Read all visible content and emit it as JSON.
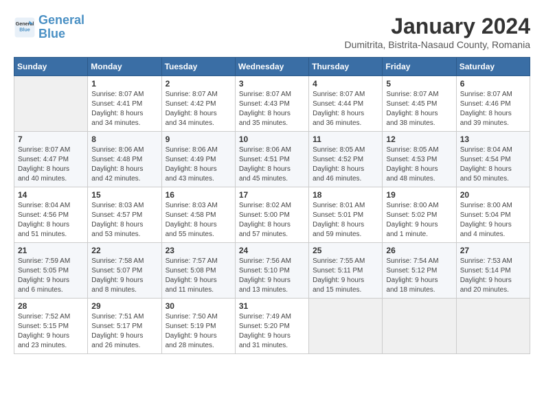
{
  "logo": {
    "line1": "General",
    "line2": "Blue"
  },
  "title": "January 2024",
  "subtitle": "Dumitrita, Bistrita-Nasaud County, Romania",
  "days_of_week": [
    "Sunday",
    "Monday",
    "Tuesday",
    "Wednesday",
    "Thursday",
    "Friday",
    "Saturday"
  ],
  "weeks": [
    [
      {
        "day": "",
        "info": ""
      },
      {
        "day": "1",
        "info": "Sunrise: 8:07 AM\nSunset: 4:41 PM\nDaylight: 8 hours\nand 34 minutes."
      },
      {
        "day": "2",
        "info": "Sunrise: 8:07 AM\nSunset: 4:42 PM\nDaylight: 8 hours\nand 34 minutes."
      },
      {
        "day": "3",
        "info": "Sunrise: 8:07 AM\nSunset: 4:43 PM\nDaylight: 8 hours\nand 35 minutes."
      },
      {
        "day": "4",
        "info": "Sunrise: 8:07 AM\nSunset: 4:44 PM\nDaylight: 8 hours\nand 36 minutes."
      },
      {
        "day": "5",
        "info": "Sunrise: 8:07 AM\nSunset: 4:45 PM\nDaylight: 8 hours\nand 38 minutes."
      },
      {
        "day": "6",
        "info": "Sunrise: 8:07 AM\nSunset: 4:46 PM\nDaylight: 8 hours\nand 39 minutes."
      }
    ],
    [
      {
        "day": "7",
        "info": ""
      },
      {
        "day": "8",
        "info": "Sunrise: 8:06 AM\nSunset: 4:48 PM\nDaylight: 8 hours\nand 42 minutes."
      },
      {
        "day": "9",
        "info": "Sunrise: 8:06 AM\nSunset: 4:49 PM\nDaylight: 8 hours\nand 43 minutes."
      },
      {
        "day": "10",
        "info": "Sunrise: 8:06 AM\nSunset: 4:51 PM\nDaylight: 8 hours\nand 45 minutes."
      },
      {
        "day": "11",
        "info": "Sunrise: 8:05 AM\nSunset: 4:52 PM\nDaylight: 8 hours\nand 46 minutes."
      },
      {
        "day": "12",
        "info": "Sunrise: 8:05 AM\nSunset: 4:53 PM\nDaylight: 8 hours\nand 48 minutes."
      },
      {
        "day": "13",
        "info": "Sunrise: 8:04 AM\nSunset: 4:54 PM\nDaylight: 8 hours\nand 50 minutes."
      }
    ],
    [
      {
        "day": "14",
        "info": ""
      },
      {
        "day": "15",
        "info": "Sunrise: 8:03 AM\nSunset: 4:57 PM\nDaylight: 8 hours\nand 53 minutes."
      },
      {
        "day": "16",
        "info": "Sunrise: 8:03 AM\nSunset: 4:58 PM\nDaylight: 8 hours\nand 55 minutes."
      },
      {
        "day": "17",
        "info": "Sunrise: 8:02 AM\nSunset: 5:00 PM\nDaylight: 8 hours\nand 57 minutes."
      },
      {
        "day": "18",
        "info": "Sunrise: 8:01 AM\nSunset: 5:01 PM\nDaylight: 8 hours\nand 59 minutes."
      },
      {
        "day": "19",
        "info": "Sunrise: 8:00 AM\nSunset: 5:02 PM\nDaylight: 9 hours\nand 1 minute."
      },
      {
        "day": "20",
        "info": "Sunrise: 8:00 AM\nSunset: 5:04 PM\nDaylight: 9 hours\nand 4 minutes."
      }
    ],
    [
      {
        "day": "21",
        "info": "Sunrise: 7:59 AM\nSunset: 5:05 PM\nDaylight: 9 hours\nand 6 minutes."
      },
      {
        "day": "22",
        "info": "Sunrise: 7:58 AM\nSunset: 5:07 PM\nDaylight: 9 hours\nand 8 minutes."
      },
      {
        "day": "23",
        "info": "Sunrise: 7:57 AM\nSunset: 5:08 PM\nDaylight: 9 hours\nand 11 minutes."
      },
      {
        "day": "24",
        "info": "Sunrise: 7:56 AM\nSunset: 5:10 PM\nDaylight: 9 hours\nand 13 minutes."
      },
      {
        "day": "25",
        "info": "Sunrise: 7:55 AM\nSunset: 5:11 PM\nDaylight: 9 hours\nand 15 minutes."
      },
      {
        "day": "26",
        "info": "Sunrise: 7:54 AM\nSunset: 5:12 PM\nDaylight: 9 hours\nand 18 minutes."
      },
      {
        "day": "27",
        "info": "Sunrise: 7:53 AM\nSunset: 5:14 PM\nDaylight: 9 hours\nand 20 minutes."
      }
    ],
    [
      {
        "day": "28",
        "info": "Sunrise: 7:52 AM\nSunset: 5:15 PM\nDaylight: 9 hours\nand 23 minutes."
      },
      {
        "day": "29",
        "info": "Sunrise: 7:51 AM\nSunset: 5:17 PM\nDaylight: 9 hours\nand 26 minutes."
      },
      {
        "day": "30",
        "info": "Sunrise: 7:50 AM\nSunset: 5:19 PM\nDaylight: 9 hours\nand 28 minutes."
      },
      {
        "day": "31",
        "info": "Sunrise: 7:49 AM\nSunset: 5:20 PM\nDaylight: 9 hours\nand 31 minutes."
      },
      {
        "day": "",
        "info": ""
      },
      {
        "day": "",
        "info": ""
      },
      {
        "day": "",
        "info": ""
      }
    ]
  ],
  "week2_sunday": "Sunrise: 8:07 AM\nSunset: 4:47 PM\nDaylight: 8 hours\nand 40 minutes.",
  "week3_sunday": "Sunrise: 8:04 AM\nSunset: 4:56 PM\nDaylight: 8 hours\nand 51 minutes."
}
